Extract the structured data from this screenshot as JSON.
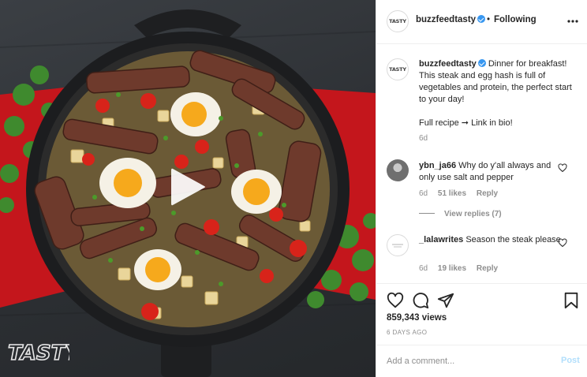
{
  "post": {
    "username": "buzzfeedtasty",
    "verified": true,
    "follow_separator": "•",
    "follow_status": "Following",
    "avatar_logo": "TASTY",
    "more_icon": "more-horizontal-icon",
    "media": {
      "watermark": "TASTY",
      "play_icon": "play-icon"
    }
  },
  "caption": {
    "username": "buzzfeedtasty",
    "text": "Dinner for breakfast! This steak and egg hash is full of vegetables and protein, the perfect start to your day!",
    "recipe_line": "Full recipe ➞ Link in bio!",
    "time": "6d"
  },
  "comments": [
    {
      "username": "ybn_ja66",
      "text": "Why do y'all always and only use salt and pepper",
      "time": "6d",
      "likes": "51 likes",
      "reply_label": "Reply",
      "view_replies": "View replies (7)"
    },
    {
      "username": "_lalawrites",
      "text": "Season the steak please",
      "time": "6d",
      "likes": "19 likes",
      "reply_label": "Reply"
    }
  ],
  "actions": {
    "icons": [
      "heart-icon",
      "comment-icon",
      "share-icon",
      "bookmark-icon"
    ],
    "views": "859,343 views",
    "posted": "6 DAYS AGO"
  },
  "composer": {
    "placeholder": "Add a comment...",
    "post_label": "Post"
  },
  "colors": {
    "verified": "#3897f0",
    "post_button_disabled": "#b2dffc",
    "secondary_text": "#8e8e8e"
  }
}
